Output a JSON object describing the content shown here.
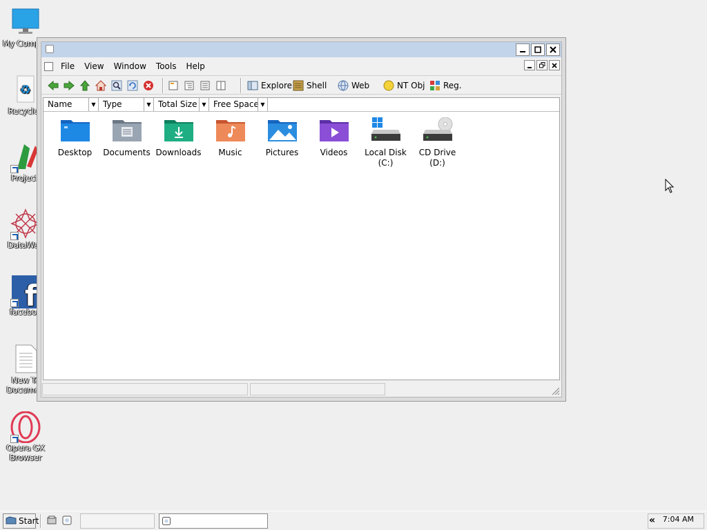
{
  "desktop": {
    "icons": [
      {
        "label": "My Comput",
        "icon": "monitor-icon"
      },
      {
        "label": "Recycle I",
        "icon": "recycle-bin-icon"
      },
      {
        "label": "Projecti",
        "icon": "project-app-icon"
      },
      {
        "label": "DataWag",
        "icon": "datawagon-icon"
      },
      {
        "label": "faceboo",
        "icon": "facebook-icon"
      },
      {
        "label": "New Te Documen",
        "icon": "text-document-icon"
      },
      {
        "label": "Opera GX Browser",
        "icon": "opera-gx-icon"
      }
    ]
  },
  "window": {
    "menu": [
      "File",
      "View",
      "Window",
      "Tools",
      "Help"
    ],
    "toolbar": {
      "explore": "Explore",
      "shell": "Shell",
      "web": "Web",
      "ntobj": "NT Obj",
      "reg": "Reg."
    },
    "columns": [
      "Name",
      "Type",
      "Total Size",
      "Free Space"
    ],
    "items": [
      {
        "label": "Desktop",
        "color": "#1e88e5"
      },
      {
        "label": "Documents",
        "color": "#8a95a5"
      },
      {
        "label": "Downloads",
        "color": "#19a37a"
      },
      {
        "label": "Music",
        "color": "#e8784d"
      },
      {
        "label": "Pictures",
        "color": "#2a8de0"
      },
      {
        "label": "Videos",
        "color": "#8a4fd6"
      },
      {
        "label": "Local Disk (C:)",
        "color": "#555555"
      },
      {
        "label": "CD Drive (D:)",
        "color": "#555555"
      }
    ]
  },
  "taskbar": {
    "start": "Start",
    "clock": "7:04 AM",
    "chevron": "«"
  }
}
